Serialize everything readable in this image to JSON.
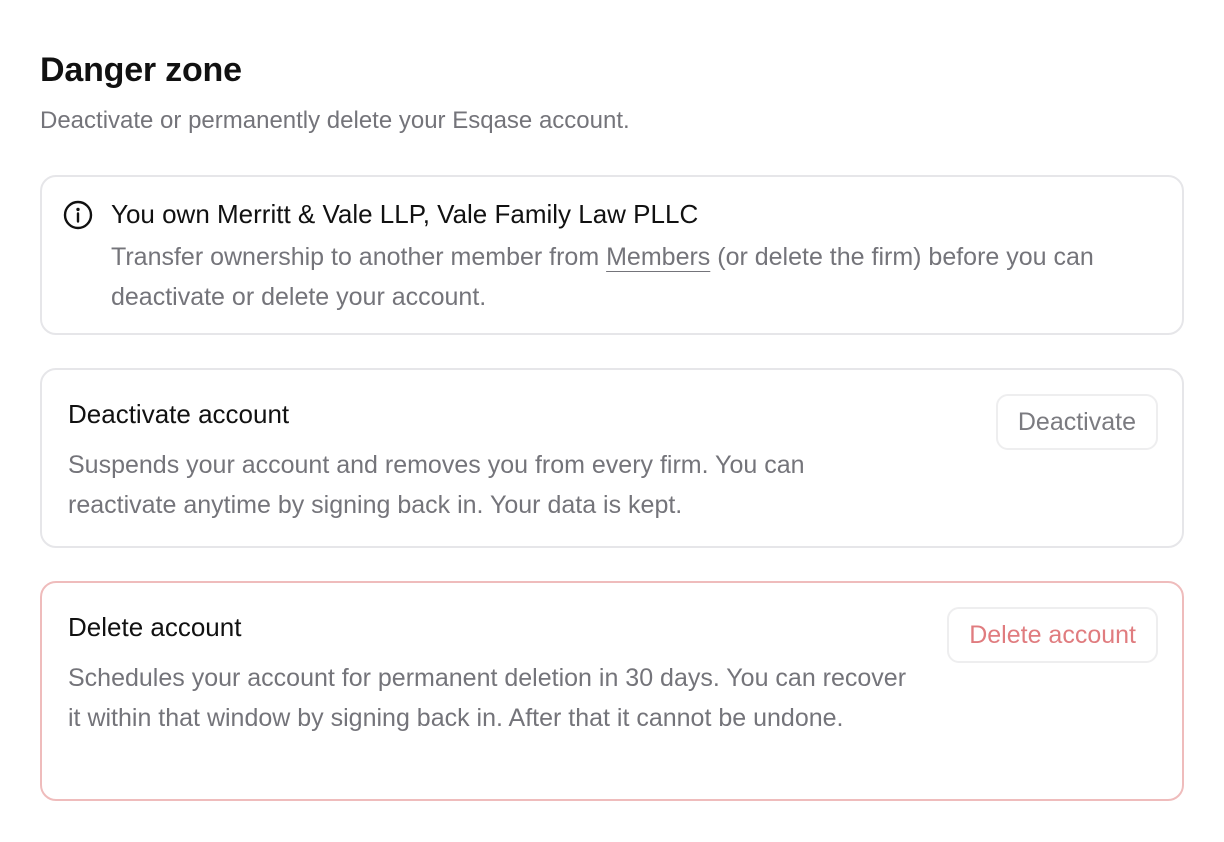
{
  "header": {
    "title": "Danger zone",
    "subtitle": "Deactivate or permanently delete your Esqase account."
  },
  "notice": {
    "icon": "info-icon",
    "title": "You own Merritt & Vale LLP, Vale Family Law PLLC",
    "text_before": "Transfer ownership to another member from ",
    "link": "Members",
    "text_after": " (or delete the firm) before you can deactivate or delete your account."
  },
  "deactivate": {
    "title": "Deactivate account",
    "description": "Suspends your account and removes you from every firm. You can reactivate anytime by signing back in. Your data is kept.",
    "button": "Deactivate"
  },
  "delete": {
    "title": "Delete account",
    "description": "Schedules your account for permanent deletion in 30 days. You can recover it within that window by signing back in. After that it cannot be undone.",
    "button": "Delete account"
  },
  "colors": {
    "danger_border": "#efbcbc",
    "danger_text": "#e07c7f",
    "muted_text": "#74747a",
    "card_border": "#e6e6e9"
  }
}
